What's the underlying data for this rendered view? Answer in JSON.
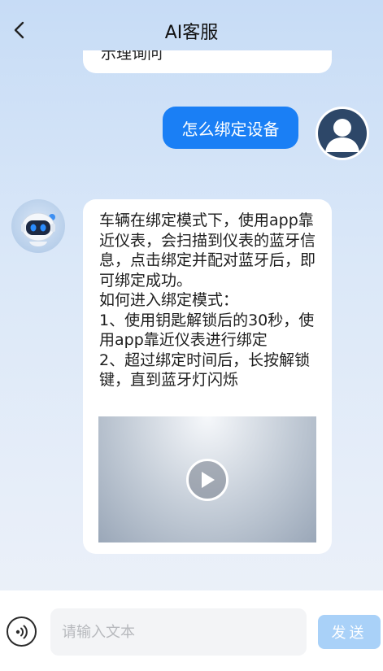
{
  "header": {
    "title": "AI客服",
    "back_icon": "chevron-left-icon"
  },
  "messages": {
    "previous_partial": " 示理询问",
    "user_message": "怎么绑定设备",
    "bot_message": "车辆在绑定模式下，使用app靠近仪表，会扫描到仪表的蓝牙信息，点击绑定并配对蓝牙后，即可绑定成功。\n如何进入绑定模式：\n1、使用钥匙解锁后的30秒，使用app靠近仪表进行绑定\n2、超过绑定时间后，长按解锁键，直到蓝牙灯闪烁",
    "video_icon": "play-icon"
  },
  "composer": {
    "placeholder": "请输入文本",
    "send_label": "发送",
    "voice_icon": "voice-icon"
  },
  "colors": {
    "accent": "#1a7ff5",
    "send_disabled": "#a9d1f8",
    "bot_eyes": "#2a8cff"
  }
}
